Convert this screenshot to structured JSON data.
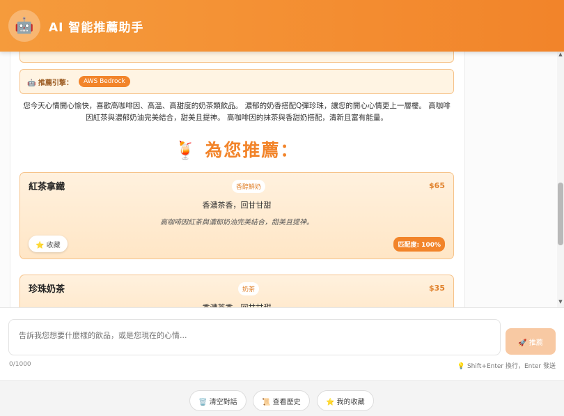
{
  "header": {
    "avatar_icon": "🤖",
    "title": "AI 智能推薦助手"
  },
  "chat": {
    "engine_label": "🤖 推薦引擎：",
    "engine_badge": "AWS Bedrock",
    "description": "您今天心情開心愉快，喜歡高咖啡因、高溫、高甜度的奶茶類飲品。 濃郁的奶香搭配Q彈珍珠，讓您的開心心情更上一層樓。 高咖啡因紅茶與濃郁奶油完美結合，甜美且提神。 高咖啡因的抹茶與香甜奶搭配，清新且富有能量。",
    "recommend_title": "🍹 為您推薦：",
    "cards": [
      {
        "name": "紅茶拿鐵",
        "tag": "香醇鮮奶",
        "price": "$65",
        "flavor": "香濃茶香，回甘甘甜",
        "reason": "高咖啡因紅茶與濃郁奶油完美結合，甜美且提神。",
        "fav_label": "⭐ 收藏",
        "match": "匹配度: 100%"
      },
      {
        "name": "珍珠奶茶",
        "tag": "奶茶",
        "price": "$35",
        "flavor": "香濃茶香，回甘甘甜"
      }
    ]
  },
  "input": {
    "placeholder": "告訴我您想要什麼樣的飲品，或是您現在的心情...",
    "send_label": "🚀 推薦",
    "counter": "0/1000",
    "hint": "💡 Shift+Enter 換行，Enter 發送"
  },
  "footer": {
    "clear_label": "🗑️ 清空對話",
    "history_label": "📜 查看歷史",
    "favorites_label": "⭐ 我的收藏"
  },
  "colors": {
    "accent": "#f2842a",
    "card_bg": "#fff1de",
    "card_border": "#f6c38a"
  }
}
